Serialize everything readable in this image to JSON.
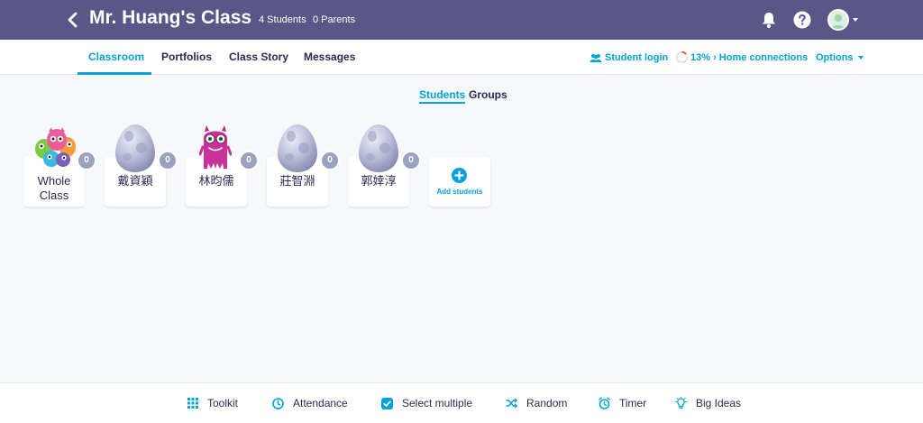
{
  "header": {
    "title": "Mr. Huang's Class",
    "students_count": "4 Students",
    "parents_count": "0 Parents"
  },
  "tabs": [
    {
      "label": "Classroom",
      "active": true
    },
    {
      "label": "Portfolios",
      "active": false
    },
    {
      "label": "Class Story",
      "active": false
    },
    {
      "label": "Messages",
      "active": false
    }
  ],
  "tabbar_right": {
    "student_login": "Student login",
    "home_connections": "13% › Home connections",
    "home_connections_percent": 13,
    "options": "Options"
  },
  "view_toggle": {
    "students": "Students",
    "groups": "Groups",
    "active": "Students"
  },
  "cards": [
    {
      "name_line1": "Whole",
      "name_line2": "Class",
      "points": "0",
      "avatar": "monster-group-icon"
    },
    {
      "name": "戴資穎",
      "points": "0",
      "avatar": "egg-icon"
    },
    {
      "name": "林昀儒",
      "points": "0",
      "avatar": "pink-monster-icon"
    },
    {
      "name": "莊智淵",
      "points": "0",
      "avatar": "egg-icon"
    },
    {
      "name": "郭婞淳",
      "points": "0",
      "avatar": "egg-icon"
    }
  ],
  "add_students": "Add students",
  "toolbar": [
    {
      "label": "Toolkit",
      "icon": "grid-icon"
    },
    {
      "label": "Attendance",
      "icon": "clock-icon"
    },
    {
      "label": "Select multiple",
      "icon": "checkbox-icon"
    },
    {
      "label": "Random",
      "icon": "shuffle-icon"
    },
    {
      "label": "Timer",
      "icon": "alarm-icon"
    },
    {
      "label": "Big Ideas",
      "icon": "lightbulb-icon"
    }
  ],
  "colors": {
    "header_bg": "#5a5788",
    "accent": "#00a3d9",
    "text": "#2c2a50",
    "page_bg": "#f7f8fc",
    "points_badge": "#9aa1bf"
  }
}
